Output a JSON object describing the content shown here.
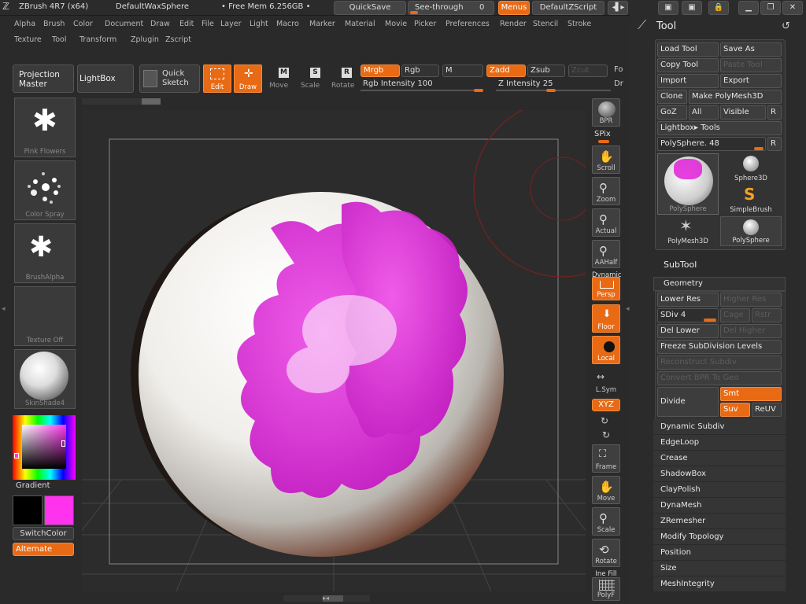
{
  "titlebar": {
    "app": "ZBrush 4R7 (x64)",
    "document": "DefaultWaxSphere",
    "mem": "• Free Mem 6.256GB •",
    "quicksave": "QuickSave",
    "see_through": "See-through",
    "see_through_value": "0",
    "menus": "Menus",
    "script": "DefaultZScript"
  },
  "menus": {
    "row1": [
      "Alpha",
      "Brush",
      "Color",
      "Document",
      "Draw",
      "Edit",
      "File",
      "Layer",
      "Light",
      "Macro",
      "Marker",
      "Material",
      "Movie",
      "Picker",
      "Preferences",
      "Render",
      "Stencil",
      "Stroke"
    ],
    "row2": [
      "Texture",
      "Tool",
      "Transform",
      "Zplugin",
      "Zscript"
    ]
  },
  "toolbar": {
    "projection_master": "Projection Master",
    "lightbox": "LightBox",
    "quick_sketch": "Quick Sketch",
    "edit": "Edit",
    "draw": "Draw",
    "move": "Move",
    "scale": "Scale",
    "rotate": "Rotate",
    "mrgb": "Mrgb",
    "rgb": "Rgb",
    "m": "M",
    "zadd": "Zadd",
    "zsub": "Zsub",
    "zcut": "Zcut",
    "rgb_intensity": "Rgb Intensity 100",
    "z_intensity": "Z Intensity 25",
    "rgb_intensity_value": 100,
    "z_intensity_value": 25,
    "fo": "Fo",
    "dr": "Dr"
  },
  "left_shelf": {
    "brush_alpha_1": "Pink Flowers",
    "color_spray": "Color Spray",
    "brush_alpha": "BrushAlpha",
    "texture": "Texture Off",
    "material": "SkinShade4",
    "gradient": "Gradient",
    "switch_color": "SwitchColor",
    "alternate": "Alternate",
    "main_color": "#000000",
    "secondary_color": "#ff33ee"
  },
  "right_tools": {
    "bpr": "BPR",
    "spix": "SPix",
    "scroll": "Scroll",
    "zoom": "Zoom",
    "actual": "Actual",
    "aahalf": "AAHalf",
    "dynamic": "Dynamic",
    "persp": "Persp",
    "floor": "Floor",
    "local": "Local",
    "lsym": "L.Sym",
    "xyz": "XYZ",
    "frame": "Frame",
    "move": "Move",
    "scale": "Scale",
    "rotate": "Rotate",
    "line_fill": "Ine Fill",
    "polyf": "PolyF"
  },
  "tool_palette": {
    "title": "Tool",
    "load_tool": "Load Tool",
    "save_as": "Save As",
    "copy_tool": "Copy Tool",
    "paste_tool": "Paste Tool",
    "import": "Import",
    "export": "Export",
    "clone": "Clone",
    "make_polymesh": "Make PolyMesh3D",
    "goz": "GoZ",
    "all": "All",
    "visible": "Visible",
    "r": "R",
    "lightbox_tools": "Lightbox▸ Tools",
    "polysphere_slider": "PolySphere. 48",
    "thumbs": [
      "PolySphere",
      "Sphere3D",
      "SimpleBrush",
      "PolyMesh3D",
      "PolySphere"
    ],
    "subtool": "SubTool",
    "geometry": "Geometry",
    "lower_res": "Lower Res",
    "higher_res": "Higher Res",
    "sdiv": "SDiv 4",
    "cage": "Cage",
    "rstr": "Rstr",
    "del_lower": "Del Lower",
    "del_higher": "Del Higher",
    "freeze": "Freeze SubDivision Levels",
    "reconstruct": "Reconstruct Subdiv",
    "convert_bpr": "Convert BPR To Geo",
    "divide": "Divide",
    "smt": "Smt",
    "suv": "Suv",
    "reuv": "ReUV",
    "sections": [
      "Dynamic Subdiv",
      "EdgeLoop",
      "Crease",
      "ShadowBox",
      "ClayPolish",
      "DynaMesh",
      "ZRemesher",
      "Modify Topology",
      "Position",
      "Size",
      "MeshIntegrity"
    ]
  },
  "colors": {
    "accent": "#e86a15",
    "paint": "#e020d8",
    "background": "#2a2a2a"
  }
}
